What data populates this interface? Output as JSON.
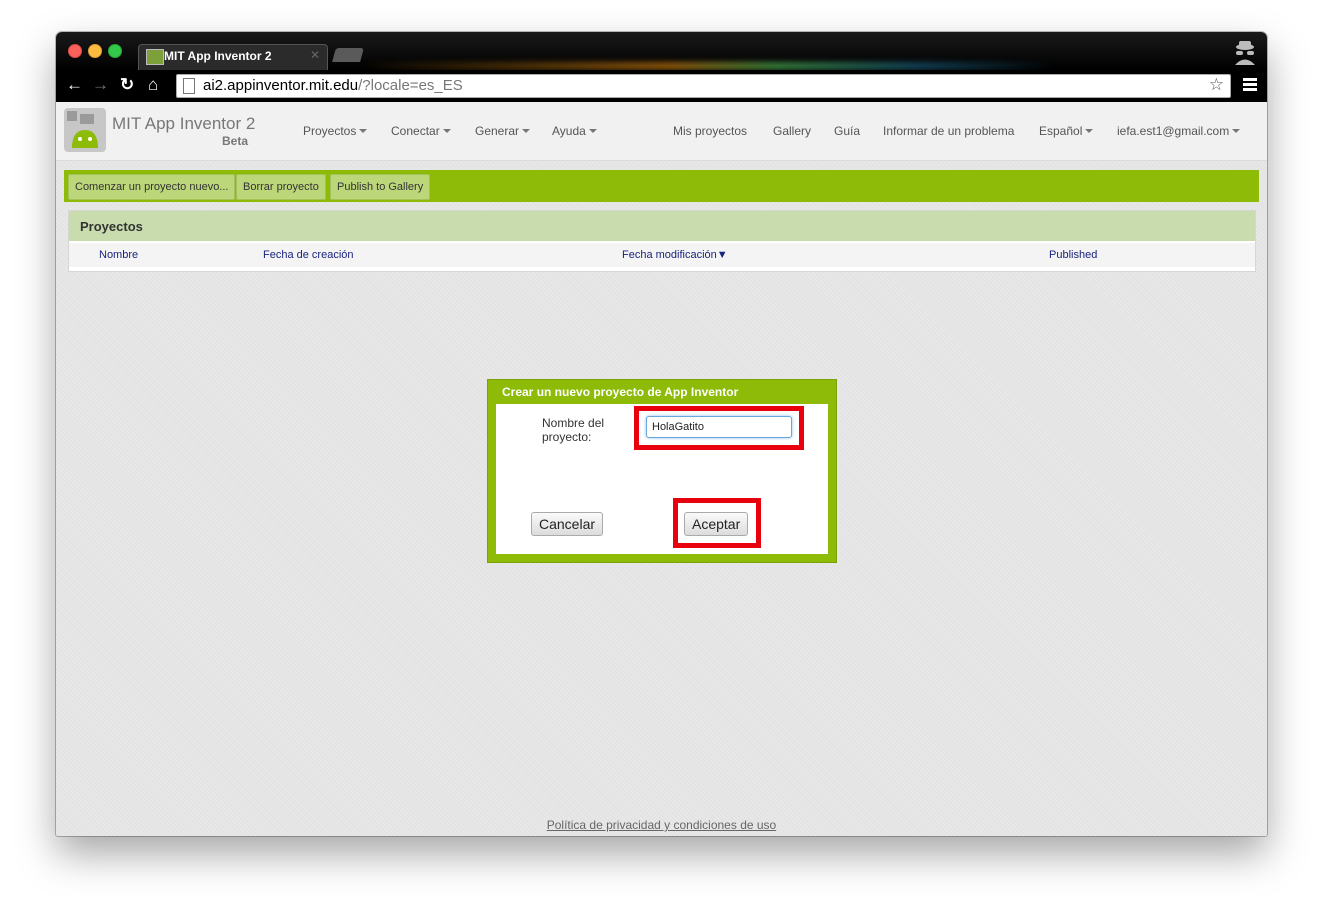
{
  "browser": {
    "tab_title": "MIT App Inventor 2",
    "url_host": "ai2.appinventor.mit.edu",
    "url_path": "/?locale=es_ES"
  },
  "app": {
    "brand": "MIT App Inventor 2",
    "beta": "Beta",
    "menus": {
      "proyectos": "Proyectos",
      "conectar": "Conectar",
      "generar": "Generar",
      "ayuda": "Ayuda",
      "mis_proyectos": "Mis proyectos",
      "gallery": "Gallery",
      "guia": "Guía",
      "informar": "Informar de un problema",
      "idioma": "Español",
      "cuenta": "iefa.est1@gmail.com"
    }
  },
  "toolbar": {
    "nuevo": "Comenzar un proyecto nuevo...",
    "borrar": "Borrar proyecto",
    "publish": "Publish to Gallery"
  },
  "projects": {
    "title": "Proyectos",
    "columns": {
      "nombre": "Nombre",
      "creacion": "Fecha de creación",
      "modificacion": "Fecha modificación▼",
      "published": "Published"
    }
  },
  "dialog": {
    "title": "Crear un nuevo proyecto de App Inventor",
    "label_line1": "Nombre del",
    "label_line2": "proyecto:",
    "input_value": "HolaGatito",
    "cancel": "Cancelar",
    "accept": "Aceptar"
  },
  "footer": {
    "link": "Política de privacidad y condiciones de uso"
  },
  "colors": {
    "accent_green": "#8dbb07",
    "highlight_red": "#e8000d"
  }
}
